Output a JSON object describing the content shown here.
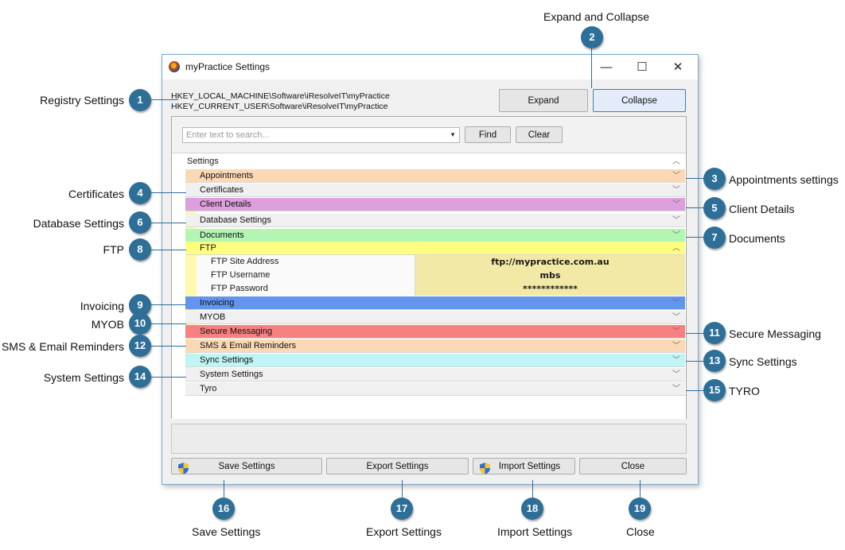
{
  "window": {
    "title": "myPractice Settings",
    "minimize_glyph": "—",
    "maximize_glyph": "☐",
    "close_glyph": "✕"
  },
  "registry": {
    "line1": "HKEY_LOCAL_MACHINE\\Software\\iResolveIT\\myPractice",
    "line2": "HKEY_CURRENT_USER\\Software\\iResolveIT\\myPractice"
  },
  "buttons": {
    "expand": "Expand",
    "collapse": "Collapse",
    "find": "Find",
    "clear": "Clear",
    "save": "Save Settings",
    "export": "Export Settings",
    "import": "Import Settings",
    "close": "Close"
  },
  "search": {
    "placeholder": "Enter text to search..."
  },
  "grid": {
    "root": "Settings",
    "categories": [
      {
        "label": "Appointments",
        "color": "#fcd9b6"
      },
      {
        "label": "Certificates",
        "color": "#f0f0f0"
      },
      {
        "label": "Client Details",
        "color": "#dda0dd"
      },
      {
        "label": "Database Settings",
        "color": "#f0f0f0"
      },
      {
        "label": "Documents",
        "color": "#b3f5b3"
      },
      {
        "label": "FTP",
        "color": "#ffff80"
      },
      {
        "label": "Invoicing",
        "color": "#6495ed"
      },
      {
        "label": "MYOB",
        "color": "#f0f0f0"
      },
      {
        "label": "Secure Messaging",
        "color": "#f78080"
      },
      {
        "label": "SMS & Email Reminders",
        "color": "#fcd9b6"
      },
      {
        "label": "Sync Settings",
        "color": "#bff5f5"
      },
      {
        "label": "System Settings",
        "color": "#f0f0f0"
      },
      {
        "label": "Tyro",
        "color": "#f0f0f0"
      }
    ],
    "ftp_fields": [
      {
        "key": "FTP Site Address",
        "value": "ftp://mypractice.com.au"
      },
      {
        "key": "FTP Username",
        "value": "mbs"
      },
      {
        "key": "FTP Password",
        "value": "************"
      }
    ]
  },
  "callouts": [
    {
      "num": "1",
      "text": "Registry Settings"
    },
    {
      "num": "2",
      "text": "Expand and Collapse"
    },
    {
      "num": "3",
      "text": "Appointments settings"
    },
    {
      "num": "4",
      "text": "Certificates"
    },
    {
      "num": "5",
      "text": "Client Details"
    },
    {
      "num": "6",
      "text": "Database Settings"
    },
    {
      "num": "7",
      "text": "Documents"
    },
    {
      "num": "8",
      "text": "FTP"
    },
    {
      "num": "9",
      "text": "Invoicing"
    },
    {
      "num": "10",
      "text": "MYOB"
    },
    {
      "num": "11",
      "text": "Secure Messaging"
    },
    {
      "num": "12",
      "text": "SMS & Email Reminders"
    },
    {
      "num": "13",
      "text": "Sync Settings"
    },
    {
      "num": "14",
      "text": "System Settings"
    },
    {
      "num": "15",
      "text": "TYRO"
    },
    {
      "num": "16",
      "text": "Save Settings"
    },
    {
      "num": "17",
      "text": "Export Settings"
    },
    {
      "num": "18",
      "text": "Import Settings"
    },
    {
      "num": "19",
      "text": "Close"
    }
  ]
}
